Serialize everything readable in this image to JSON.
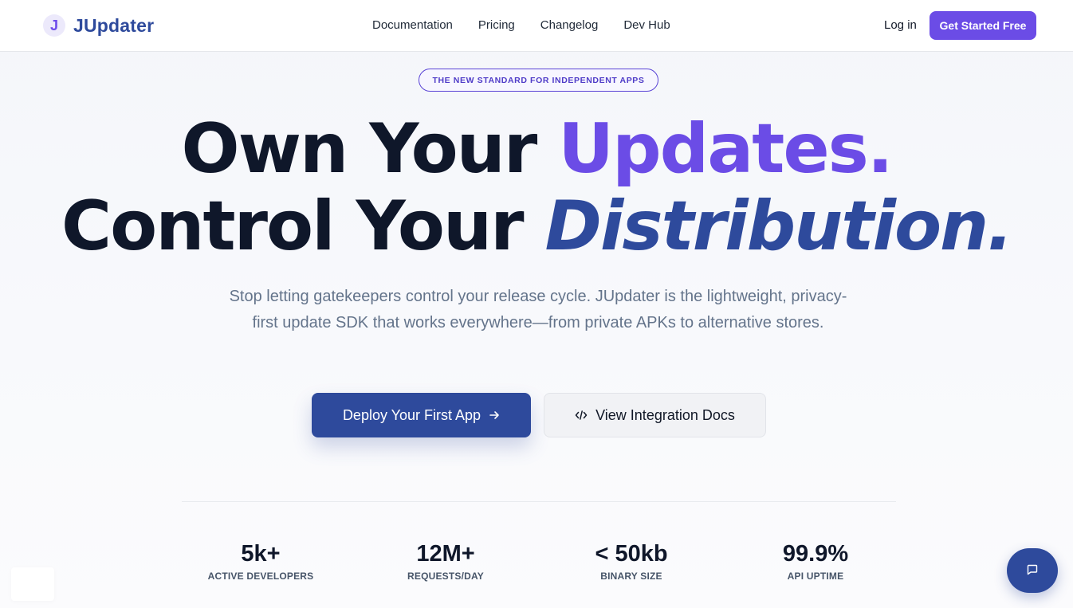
{
  "brand": {
    "logo_letter": "J",
    "name": "JUpdater"
  },
  "nav": {
    "links": [
      "Documentation",
      "Pricing",
      "Changelog",
      "Dev Hub"
    ],
    "login": "Log in",
    "cta": "Get Started Free"
  },
  "hero": {
    "badge": "THE NEW STANDARD FOR INDEPENDENT APPS",
    "line1_part1": "Own Your ",
    "line1_accent": "Updates.",
    "line2_part1": "Control Your ",
    "line2_accent": "Distribution.",
    "subtext": "Stop letting gatekeepers control your release cycle. JUpdater is the lightweight, privacy-first update SDK that works everywhere—from private APKs to alternative stores.",
    "primary_button": "Deploy Your First App",
    "secondary_button": "View Integration Docs"
  },
  "stats": [
    {
      "value": "5k+",
      "label": "ACTIVE DEVELOPERS"
    },
    {
      "value": "12M+",
      "label": "REQUESTS/DAY"
    },
    {
      "value": "< 50kb",
      "label": "BINARY SIZE"
    },
    {
      "value": "99.9%",
      "label": "API UPTIME"
    }
  ],
  "colors": {
    "brand_purple": "#6b4ce6",
    "brand_blue": "#2e4a9c",
    "text_dark": "#0f172a",
    "text_muted": "#64748b"
  },
  "icons": [
    "arrow-right-icon",
    "code-icon",
    "chat-icon"
  ]
}
